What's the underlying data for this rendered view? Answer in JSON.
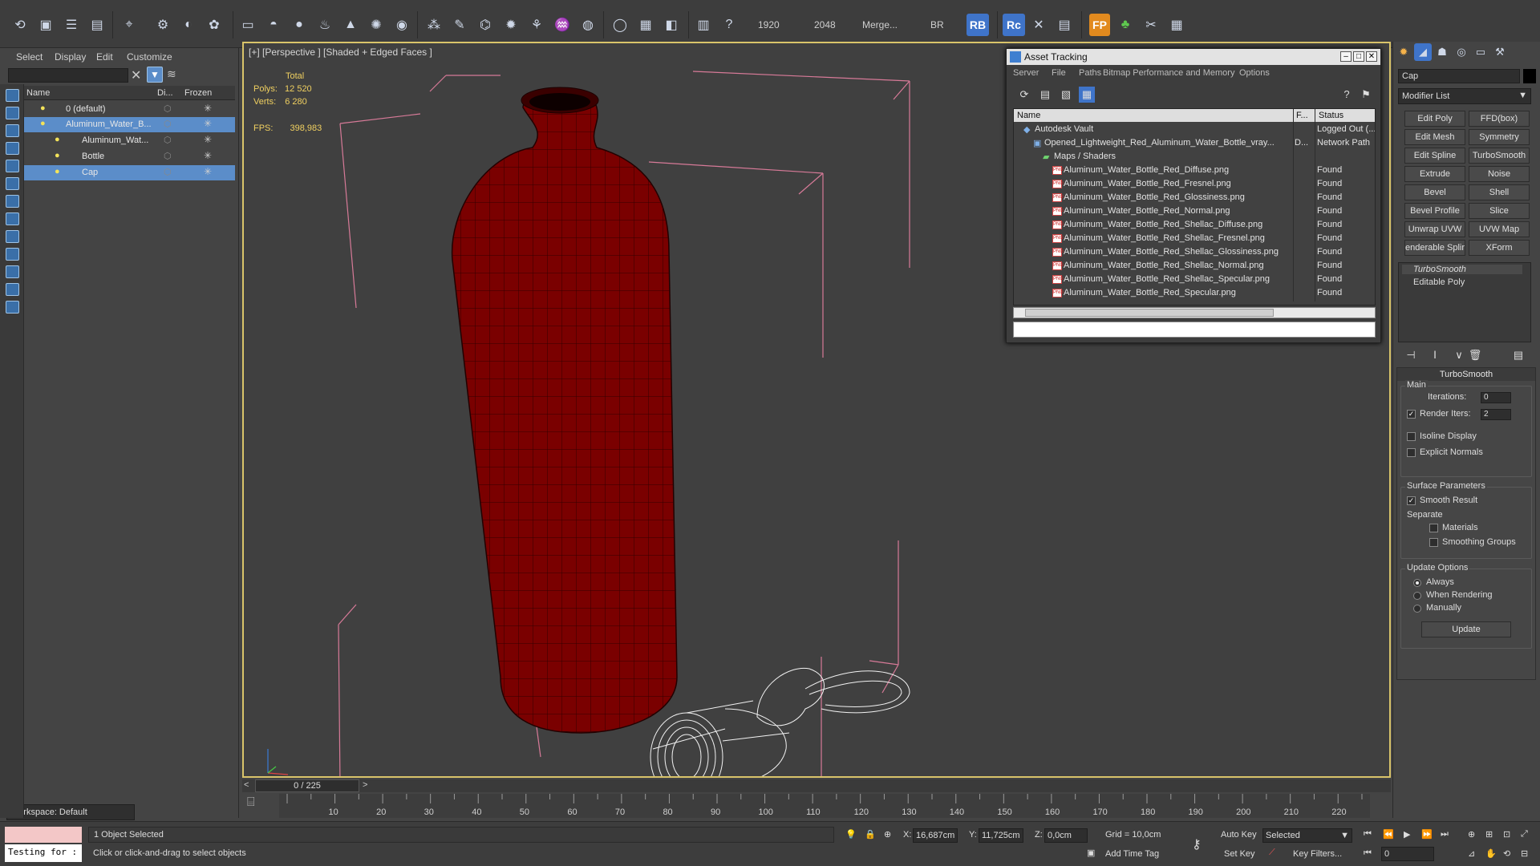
{
  "toolbar": {
    "icons": [
      "undo-icon",
      "open-icon",
      "list-icon",
      "window-icon",
      "select-icon",
      "link-icon",
      "bind-icon",
      "grid-icon",
      "sun-icon",
      "sphere-icon",
      "particle-icon",
      "texture-icon",
      "light-icon",
      "cone-icon",
      "star-icon",
      "weld-icon",
      "material-icon",
      "render-icon"
    ],
    "render_width": "1920",
    "render_height": "2048",
    "merge_label": "Merge...",
    "br_label": "BR",
    "rb_label": "RB",
    "rc_label": "Rc",
    "fp_label": "FP"
  },
  "scene_explorer": {
    "menu": [
      "Select",
      "Display",
      "Edit",
      "Customize"
    ],
    "columns": [
      "Name",
      "Di...",
      "Frozen"
    ],
    "rows": [
      {
        "name": "0 (default)",
        "indent": 0,
        "selected": false
      },
      {
        "name": "Aluminum_Water_B...",
        "indent": 1,
        "selected": true
      },
      {
        "name": "Aluminum_Wat...",
        "indent": 2,
        "selected": false
      },
      {
        "name": "Bottle",
        "indent": 2,
        "selected": false
      },
      {
        "name": "Cap",
        "indent": 2,
        "selected": true
      }
    ],
    "workspace": "Workspace: Default"
  },
  "viewport": {
    "label": "[+] [Perspective ] [Shaded + Edged Faces ]",
    "stats": {
      "total_label": "Total",
      "polys_label": "Polys:",
      "polys": "12 520",
      "verts_label": "Verts:",
      "verts": "6 280",
      "fps_label": "FPS:",
      "fps": "398,983"
    }
  },
  "asset_tracking": {
    "title": "Asset Tracking",
    "menu": [
      "Server",
      "File",
      "Paths",
      "Bitmap Performance and Memory",
      "Options"
    ],
    "columns": [
      "Name",
      "F...",
      "Status"
    ],
    "rows": [
      {
        "name": "Autodesk Vault",
        "f": "",
        "status": "Logged Out (...",
        "indent": 1,
        "type": "vault"
      },
      {
        "name": "Opened_Lightweight_Red_Aluminum_Water_Bottle_vray...",
        "f": "D...",
        "status": "Network Path",
        "indent": 2,
        "type": "max"
      },
      {
        "name": "Maps / Shaders",
        "f": "",
        "status": "",
        "indent": 3,
        "type": "folder"
      },
      {
        "name": "Aluminum_Water_Bottle_Red_Diffuse.png",
        "f": "",
        "status": "Found",
        "indent": 4,
        "type": "png"
      },
      {
        "name": "Aluminum_Water_Bottle_Red_Fresnel.png",
        "f": "",
        "status": "Found",
        "indent": 4,
        "type": "png"
      },
      {
        "name": "Aluminum_Water_Bottle_Red_Glossiness.png",
        "f": "",
        "status": "Found",
        "indent": 4,
        "type": "png"
      },
      {
        "name": "Aluminum_Water_Bottle_Red_Normal.png",
        "f": "",
        "status": "Found",
        "indent": 4,
        "type": "png"
      },
      {
        "name": "Aluminum_Water_Bottle_Red_Shellac_Diffuse.png",
        "f": "",
        "status": "Found",
        "indent": 4,
        "type": "png"
      },
      {
        "name": "Aluminum_Water_Bottle_Red_Shellac_Fresnel.png",
        "f": "",
        "status": "Found",
        "indent": 4,
        "type": "png"
      },
      {
        "name": "Aluminum_Water_Bottle_Red_Shellac_Glossiness.png",
        "f": "",
        "status": "Found",
        "indent": 4,
        "type": "png"
      },
      {
        "name": "Aluminum_Water_Bottle_Red_Shellac_Normal.png",
        "f": "",
        "status": "Found",
        "indent": 4,
        "type": "png"
      },
      {
        "name": "Aluminum_Water_Bottle_Red_Shellac_Specular.png",
        "f": "",
        "status": "Found",
        "indent": 4,
        "type": "png"
      },
      {
        "name": "Aluminum_Water_Bottle_Red_Specular.png",
        "f": "",
        "status": "Found",
        "indent": 4,
        "type": "png"
      }
    ]
  },
  "command_panel": {
    "object_name": "Cap",
    "modifier_list": "Modifier List",
    "buttons": [
      "Edit Poly",
      "FFD(box)",
      "Edit Mesh",
      "Symmetry",
      "Edit Spline",
      "TurboSmooth",
      "Extrude",
      "Noise",
      "Bevel",
      "Shell",
      "Bevel Profile",
      "Slice",
      "Unwrap UVW",
      "UVW Map",
      "enderable Splir",
      "XForm"
    ],
    "stack": [
      "TurboSmooth",
      "Editable Poly"
    ],
    "turbosmooth": {
      "title": "TurboSmooth",
      "main_label": "Main",
      "iterations_label": "Iterations:",
      "iterations": "0",
      "render_iters_label": "Render Iters:",
      "render_iters": "2",
      "isoline_label": "Isoline Display",
      "explicit_label": "Explicit Normals",
      "surface_label": "Surface Parameters",
      "smooth_result_label": "Smooth Result",
      "separate_label": "Separate",
      "materials_label": "Materials",
      "smoothing_label": "Smoothing Groups",
      "update_options_label": "Update Options",
      "always_label": "Always",
      "when_rendering_label": "When Rendering",
      "manually_label": "Manually",
      "update_button": "Update"
    }
  },
  "timeline": {
    "slider": "0 / 225",
    "ticks": [
      "10",
      "20",
      "30",
      "40",
      "50",
      "60",
      "70",
      "80",
      "90",
      "100",
      "110",
      "120",
      "130",
      "140",
      "150",
      "160",
      "170",
      "180",
      "190",
      "200",
      "210",
      "220"
    ]
  },
  "status": {
    "maxscript_text": "Testing for :",
    "selection": "1 Object Selected",
    "prompt": "Click or click-and-drag to select objects",
    "x_label": "X:",
    "x": "16,687cm",
    "y_label": "Y:",
    "y": "11,725cm",
    "z_label": "Z:",
    "z": "0,0cm",
    "grid": "Grid = 10,0cm",
    "add_time_tag": "Add Time Tag",
    "auto_key": "Auto Key",
    "set_key": "Set Key",
    "selected": "Selected",
    "key_filters": "Key Filters...",
    "frame": "0"
  }
}
